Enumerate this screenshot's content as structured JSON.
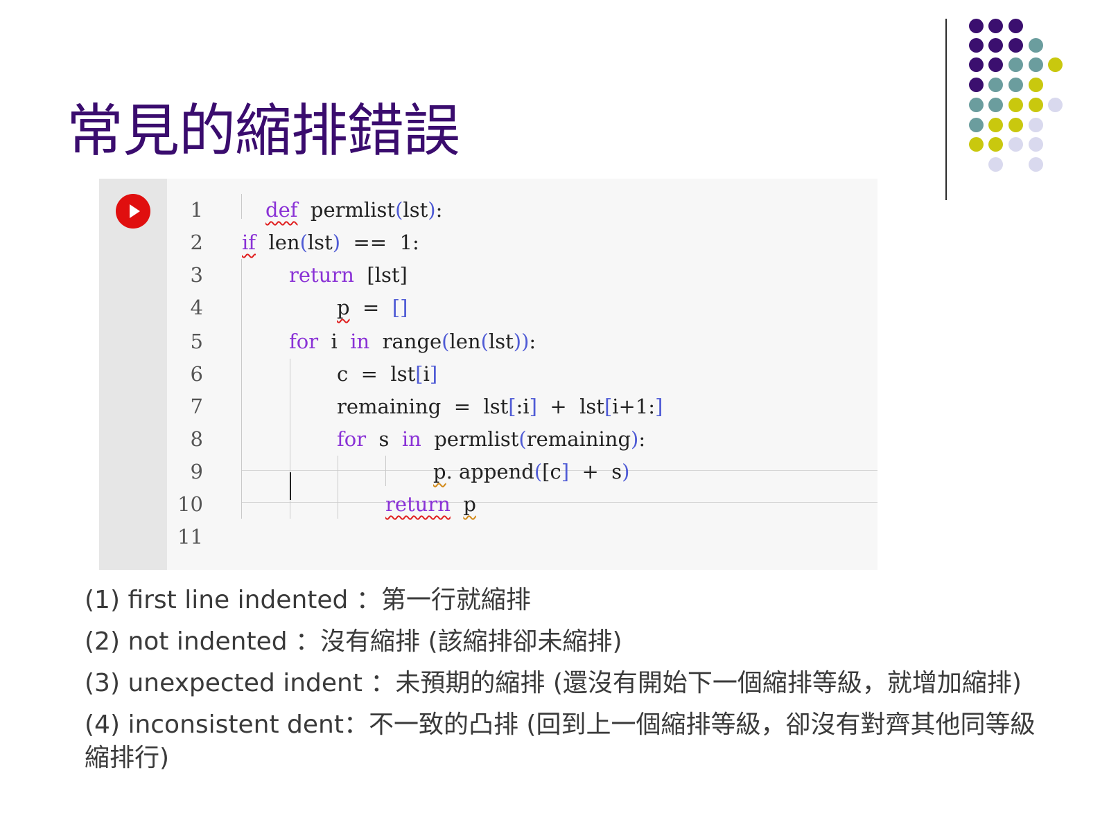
{
  "slide": {
    "title": "常見的縮排錯誤"
  },
  "decor": {
    "colors": {
      "purple": "#3b0f6f",
      "teal": "#6b9d9e",
      "yellow": "#c9c80e",
      "lavender": "#d9d9ee"
    },
    "icon": "dot-grid"
  },
  "editor": {
    "run_icon": "play-icon",
    "line_numbers": [
      "1",
      "2",
      "3",
      "4",
      "5",
      "6",
      "7",
      "8",
      "9",
      "10",
      "11"
    ],
    "code": {
      "l1": {
        "kw": "def",
        "rest": "  permlist",
        "p1": "(",
        "arg": "lst",
        "p2": ")",
        "colon": ":"
      },
      "l2": {
        "kw": "if",
        "a": "  len",
        "p1": "(",
        "arg": "lst",
        "p2": ")",
        "rest": "  ==  1:"
      },
      "l3": {
        "kw": "return",
        "a": "  ",
        "b1": "[",
        "arg": "lst",
        "b2": "]"
      },
      "l4": {
        "var": "p",
        "a": "  =  ",
        "brackets": "[]"
      },
      "l5": {
        "kw": "for",
        "a": "  i  ",
        "kw2": "in",
        "b": "  range",
        "p1": "(",
        "c": "len",
        "p2": "(",
        "arg": "lst",
        "p3": "))",
        "colon": ":"
      },
      "l6": {
        "a": "c  =  lst",
        "b1": "[",
        "arg": "i",
        "b2": "]"
      },
      "l7": {
        "a": "remaining  =  lst",
        "b1": "[",
        "arg": ":i",
        "b2": "]",
        "b": "  +  lst",
        "b3": "[",
        "arg2": "i+1:",
        "b4": "]"
      },
      "l8": {
        "kw": "for",
        "a": "  s  ",
        "kw2": "in",
        "b": "  permlist",
        "p1": "(",
        "arg": "remaining",
        "p2": ")",
        "colon": ":"
      },
      "l9": {
        "var": "p",
        "a": ". append",
        "p1": "(",
        "b1": "[",
        "arg": "c",
        "b2": "]",
        "b": "  +  s",
        "p2": ")"
      },
      "l10": {
        "kw": "return",
        "a": "  ",
        "var": "p"
      }
    }
  },
  "notes": [
    "(1) first line indented  ：第一行就縮排",
    "(2) not indented  ：沒有縮排 (該縮排卻未縮排)",
    "(3) unexpected indent  ：未預期的縮排 (還沒有開始下一個縮排等級，就增加縮排)",
    "(4) inconsistent dent：不一致的凸排 (回到上一個縮排等級，卻沒有對齊其他同等級",
    "縮排行)"
  ]
}
